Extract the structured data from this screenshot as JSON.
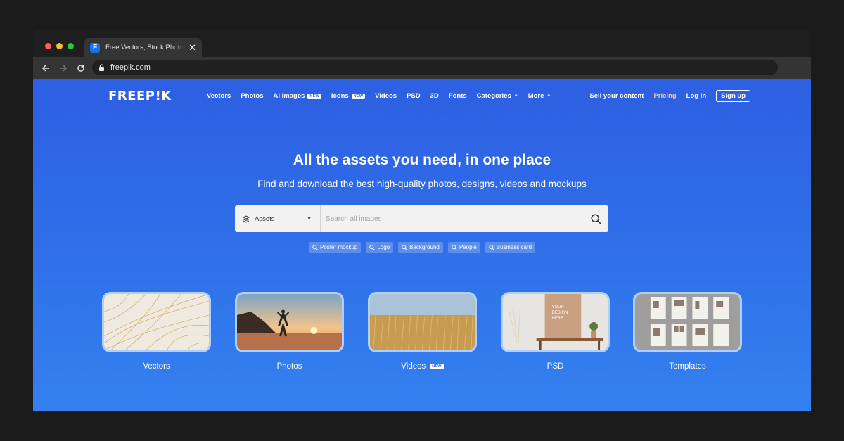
{
  "browser": {
    "tab_title": "Free Vectors, Stock Photos",
    "tab_close": "✕",
    "favicon_letter": "F",
    "url": "freepik.com"
  },
  "nav": {
    "logo": "FREEP!K",
    "items": [
      {
        "label": "Vectors"
      },
      {
        "label": "Photos"
      },
      {
        "label": "AI Images",
        "badge": "NEW"
      },
      {
        "label": "Icons",
        "badge": "NEW"
      },
      {
        "label": "Videos"
      },
      {
        "label": "PSD"
      },
      {
        "label": "3D"
      },
      {
        "label": "Fonts"
      },
      {
        "label": "Categories",
        "caret": "▼"
      },
      {
        "label": "More",
        "caret": "▼"
      }
    ],
    "sell": "Sell your content",
    "pricing": "Pricing",
    "login": "Log in",
    "signup": "Sign up"
  },
  "hero": {
    "title": "All the assets you need, in one place",
    "subtitle": "Find and download the best high-quality photos, designs, videos and mockups"
  },
  "search": {
    "asset_type": "Assets",
    "asset_caret": "▼",
    "placeholder": "Search all images"
  },
  "chips": [
    "Poster mockup",
    "Logo",
    "Background",
    "People",
    "Business card"
  ],
  "categories": [
    {
      "label": "Vectors"
    },
    {
      "label": "Photos"
    },
    {
      "label": "Videos",
      "badge": "NEW"
    },
    {
      "label": "PSD",
      "mockup_text": [
        "YOUR",
        "DESIGN",
        "HERE"
      ]
    },
    {
      "label": "Templates"
    }
  ],
  "colors": {
    "brand_blue": "#2d5fe2",
    "pricing_accent": "#f6c58b"
  }
}
